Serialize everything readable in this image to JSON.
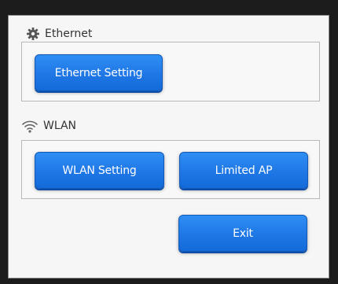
{
  "ethernet": {
    "title": "Ethernet",
    "setting_button": "Ethernet Setting"
  },
  "wlan": {
    "title": "WLAN",
    "setting_button": "WLAN Setting",
    "limited_ap_button": "Limited AP"
  },
  "footer": {
    "exit_button": "Exit"
  },
  "colors": {
    "button": "#1f77e6",
    "panel": "#f6f6f6",
    "frame": "#1c1c1c"
  },
  "icons": {
    "ethernet": "gear-icon",
    "wlan": "wifi-icon"
  }
}
